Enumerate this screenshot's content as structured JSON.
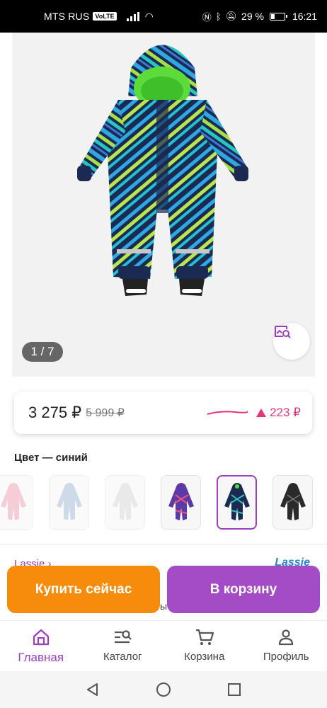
{
  "status_bar": {
    "carrier": "MTS RUS",
    "volte": "VoLTE",
    "battery": "29 %",
    "time": "16:21"
  },
  "gallery": {
    "counter": "1 / 7"
  },
  "price": {
    "current": "3 275 ₽",
    "old": "5 999 ₽",
    "delta": "223 ₽",
    "accent_color": "#e5367d"
  },
  "color": {
    "label": "Цвет — синий",
    "swatches": [
      "pink",
      "light-blue",
      "white",
      "purple",
      "blue-green",
      "black"
    ],
    "selected_index": 4
  },
  "brand": {
    "link": "Lassie ›",
    "logo": "Lassie"
  },
  "obscured_text": "ы",
  "actions": {
    "buy_now": "Купить сейчас",
    "add_to_cart": "В корзину",
    "buy_color": "#f78b0c",
    "cart_color": "#a44bc6"
  },
  "bottom_nav": {
    "items": [
      {
        "label": "Главная",
        "icon": "home-icon"
      },
      {
        "label": "Каталог",
        "icon": "catalog-search-icon"
      },
      {
        "label": "Корзина",
        "icon": "cart-icon"
      },
      {
        "label": "Профиль",
        "icon": "profile-icon"
      }
    ],
    "active_index": 0
  }
}
